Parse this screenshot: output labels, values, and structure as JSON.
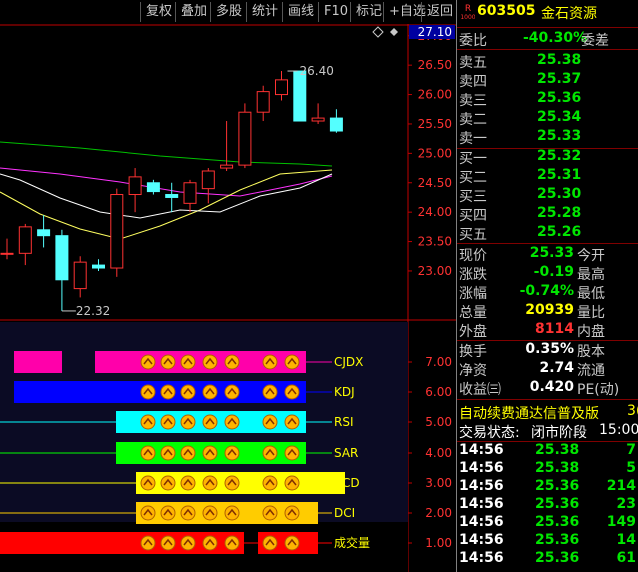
{
  "toolbar": {
    "buttons": [
      "复权",
      "叠加",
      "多股",
      "统计",
      "画线",
      "F10",
      "标记",
      "+自选",
      "返回"
    ]
  },
  "chart": {
    "price_axis": [
      "27.00",
      "26.50",
      "26.00",
      "25.50",
      "25.00",
      "24.50",
      "24.00",
      "23.50",
      "23.00"
    ],
    "current_price_tag": "27.10",
    "high_label": "26.40",
    "low_label": "22.32",
    "indicator_axis": [
      "7.00",
      "6.00",
      "5.00",
      "4.00",
      "3.00",
      "2.00",
      "1.00"
    ],
    "indicators": [
      "CJDX",
      "KDJ",
      "RSI",
      "SAR",
      "ACD",
      "DCI",
      "成交量"
    ],
    "chart_data": {
      "type": "candlestick",
      "ylim": [
        22.2,
        27.2
      ],
      "candles": [
        {
          "o": 23.3,
          "h": 23.55,
          "l": 23.2,
          "c": 23.3
        },
        {
          "o": 23.3,
          "h": 23.8,
          "l": 23.1,
          "c": 23.75
        },
        {
          "o": 23.7,
          "h": 23.95,
          "l": 23.4,
          "c": 23.6
        },
        {
          "o": 23.6,
          "h": 23.7,
          "l": 22.32,
          "c": 22.85
        },
        {
          "o": 22.7,
          "h": 23.25,
          "l": 22.55,
          "c": 23.15
        },
        {
          "o": 23.1,
          "h": 23.2,
          "l": 23.0,
          "c": 23.05
        },
        {
          "o": 23.05,
          "h": 24.4,
          "l": 22.9,
          "c": 24.3
        },
        {
          "o": 24.3,
          "h": 24.75,
          "l": 24.0,
          "c": 24.6
        },
        {
          "o": 24.5,
          "h": 24.55,
          "l": 24.3,
          "c": 24.35
        },
        {
          "o": 24.3,
          "h": 24.5,
          "l": 24.0,
          "c": 24.25
        },
        {
          "o": 24.15,
          "h": 24.55,
          "l": 24.0,
          "c": 24.5
        },
        {
          "o": 24.4,
          "h": 24.75,
          "l": 24.15,
          "c": 24.7
        },
        {
          "o": 24.75,
          "h": 25.55,
          "l": 24.7,
          "c": 24.8
        },
        {
          "o": 24.8,
          "h": 25.85,
          "l": 24.75,
          "c": 25.7
        },
        {
          "o": 25.7,
          "h": 26.15,
          "l": 25.55,
          "c": 26.05
        },
        {
          "o": 26.0,
          "h": 26.4,
          "l": 25.9,
          "c": 26.25
        },
        {
          "o": 26.4,
          "h": 26.4,
          "l": 25.55,
          "c": 25.55
        },
        {
          "o": 25.55,
          "h": 25.85,
          "l": 25.5,
          "c": 25.6
        },
        {
          "o": 25.6,
          "h": 25.75,
          "l": 25.35,
          "c": 25.38
        }
      ]
    }
  },
  "panel": {
    "code": "603505",
    "name": "金石资源",
    "badge": "R",
    "badge_sub": "1000",
    "webi_label": "委比",
    "webi_value": "-40.30%",
    "wecha_label": "委差",
    "asks": [
      {
        "label": "卖五",
        "price": "25.38"
      },
      {
        "label": "卖四",
        "price": "25.37"
      },
      {
        "label": "卖三",
        "price": "25.36"
      },
      {
        "label": "卖二",
        "price": "25.34"
      },
      {
        "label": "卖一",
        "price": "25.33"
      }
    ],
    "bids": [
      {
        "label": "买一",
        "price": "25.32"
      },
      {
        "label": "买二",
        "price": "25.31"
      },
      {
        "label": "买三",
        "price": "25.30"
      },
      {
        "label": "买四",
        "price": "25.28"
      },
      {
        "label": "买五",
        "price": "25.26"
      }
    ],
    "stats": [
      {
        "l1": "现价",
        "v": "25.33",
        "vc": "green",
        "l2": "今开"
      },
      {
        "l1": "涨跌",
        "v": "-0.19",
        "vc": "green",
        "l2": "最高"
      },
      {
        "l1": "涨幅",
        "v": "-0.74%",
        "vc": "green",
        "l2": "最低"
      },
      {
        "l1": "总量",
        "v": "20939",
        "vc": "yellow",
        "l2": "量比"
      },
      {
        "l1": "外盘",
        "v": "8114",
        "vc": "red",
        "l2": "内盘"
      }
    ],
    "stats2": [
      {
        "l1": "换手",
        "v": "0.35%",
        "vc": "white",
        "l2": "股本"
      },
      {
        "l1": "净资",
        "v": "2.74",
        "vc": "white",
        "l2": "流通"
      },
      {
        "l1": "收益㈢",
        "v": "0.420",
        "vc": "white",
        "l2": "PE(动)"
      }
    ],
    "marquee": "自动续费通达信普及版",
    "marquee_tail": "3(",
    "status_label": "交易状态:",
    "status_value": "闭市阶段",
    "status_time": "15:00:",
    "ticks": [
      {
        "t": "14:56",
        "p": "25.38",
        "v": "7"
      },
      {
        "t": "14:56",
        "p": "25.38",
        "v": "5"
      },
      {
        "t": "14:56",
        "p": "25.36",
        "v": "214"
      },
      {
        "t": "14:56",
        "p": "25.36",
        "v": "23"
      },
      {
        "t": "14:56",
        "p": "25.36",
        "v": "149"
      },
      {
        "t": "14:56",
        "p": "25.36",
        "v": "14"
      },
      {
        "t": "14:56",
        "p": "25.36",
        "v": "61"
      }
    ]
  }
}
